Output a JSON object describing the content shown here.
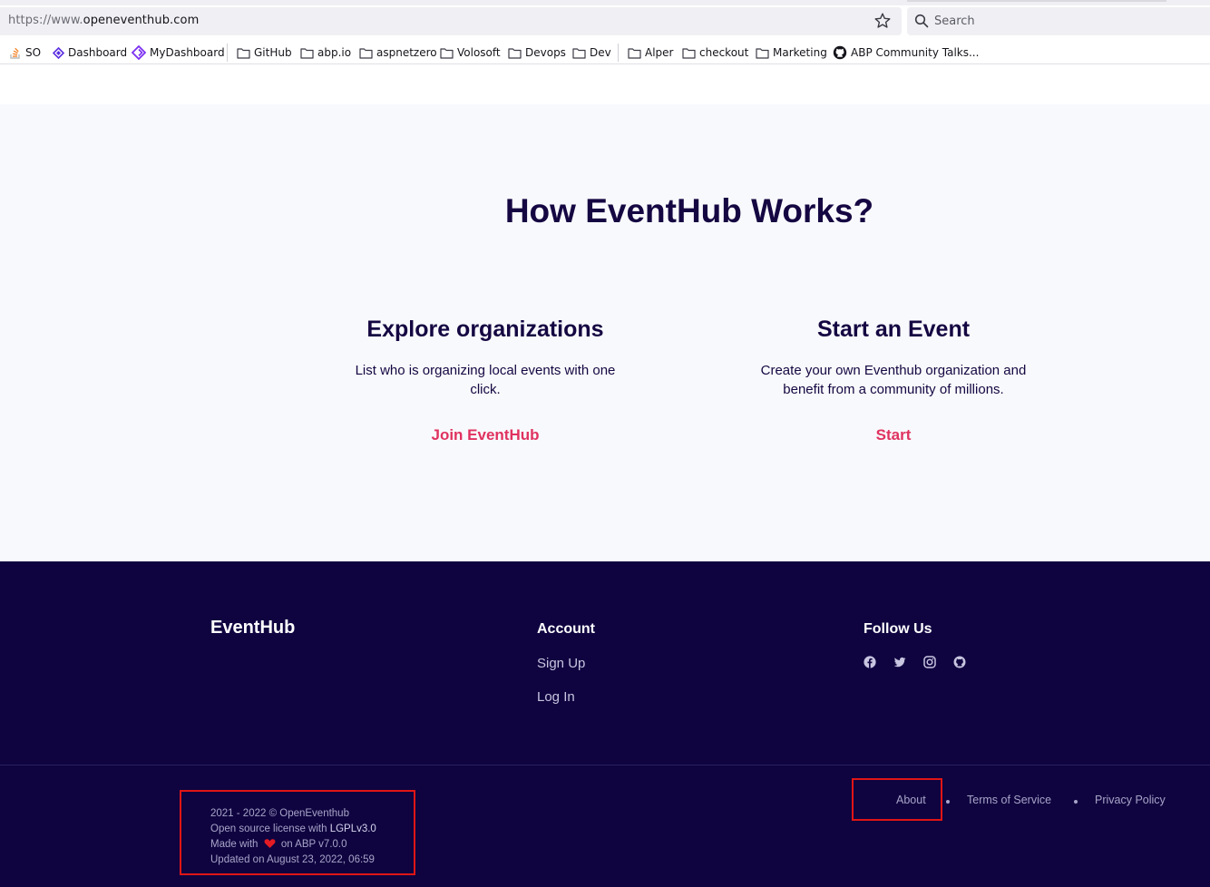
{
  "browser": {
    "url_scheme": "https://www.",
    "url_host": "openeventhub.com",
    "search_placeholder": "Search"
  },
  "bookmarks": [
    {
      "label": "SO",
      "icon": "stackoverflow-icon"
    },
    {
      "label": "Dashboard",
      "icon": "dashboard-icon"
    },
    {
      "label": "MyDashboard",
      "icon": "mydashboard-icon"
    },
    {
      "label": "GitHub",
      "icon": "folder-icon"
    },
    {
      "label": "abp.io",
      "icon": "folder-icon"
    },
    {
      "label": "aspnetzero",
      "icon": "folder-icon"
    },
    {
      "label": "Volosoft",
      "icon": "folder-icon"
    },
    {
      "label": "Devops",
      "icon": "folder-icon"
    },
    {
      "label": "Dev",
      "icon": "folder-icon"
    },
    {
      "label": "Alper",
      "icon": "folder-icon"
    },
    {
      "label": "checkout",
      "icon": "folder-icon"
    },
    {
      "label": "Marketing",
      "icon": "folder-icon"
    },
    {
      "label": "ABP Community Talks...",
      "icon": "github-icon"
    }
  ],
  "how": {
    "title": "How EventHub Works?",
    "explore": {
      "title": "Explore organizations",
      "text": "List who is organizing local events with one click.",
      "link": "Join EventHub"
    },
    "start": {
      "title": "Start an Event",
      "text": "Create your own Eventhub organization and benefit from a community of millions.",
      "link": "Start"
    }
  },
  "footer": {
    "brand": "EventHub",
    "account": {
      "title": "Account",
      "signup": "Sign Up",
      "login": "Log In"
    },
    "follow": {
      "title": "Follow Us",
      "icons": [
        "facebook-icon",
        "twitter-icon",
        "instagram-icon",
        "github-icon"
      ]
    },
    "copyright": "2021 - 2022 © OpenEventhub",
    "license_prefix": "Open source license with ",
    "license_name": "LGPLv3.0",
    "made_with_prefix": "Made with",
    "made_with_suffix": "on ABP v7.0.0",
    "updated": "Updated on August 23, 2022, 06:59",
    "links": {
      "about": "About",
      "terms": "Terms of Service",
      "privacy": "Privacy Policy"
    }
  },
  "colors": {
    "navy": "#150742",
    "footer_bg": "#0f0440",
    "accent": "#e0325f",
    "annotation": "#e01515"
  }
}
